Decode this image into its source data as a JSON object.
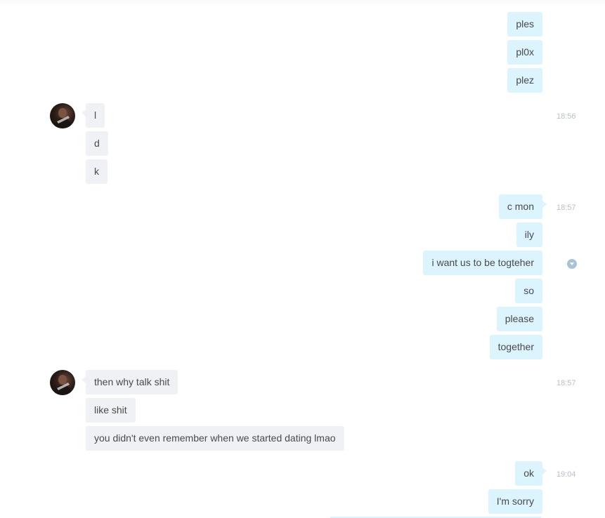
{
  "messages": {
    "m1": "ples",
    "m2": "pl0x",
    "m3": "plez",
    "m4": "l",
    "m5": "d",
    "m6": "k",
    "m7": "c mon",
    "m8": "ily",
    "m9": "i want us to be togteher",
    "m10": "so",
    "m11": "please",
    "m12": "together",
    "m13": "then why talk shit",
    "m14": "like shit",
    "m15": "you didn't even remember when we started dating lmao",
    "m16": "ok",
    "m17": "I'm sorry"
  },
  "times": {
    "t1": "18:56",
    "t2": "18:57",
    "t3": "18:57",
    "t4": "19:04"
  },
  "colors": {
    "outgoing_bubble": "#dbf4fd",
    "incoming_bubble": "#eff1f4",
    "timestamp": "#b8bfc7",
    "text": "#4a4a4a"
  },
  "icons": {
    "avatar": "contact-avatar",
    "status": "chevron-down-circle-icon"
  }
}
